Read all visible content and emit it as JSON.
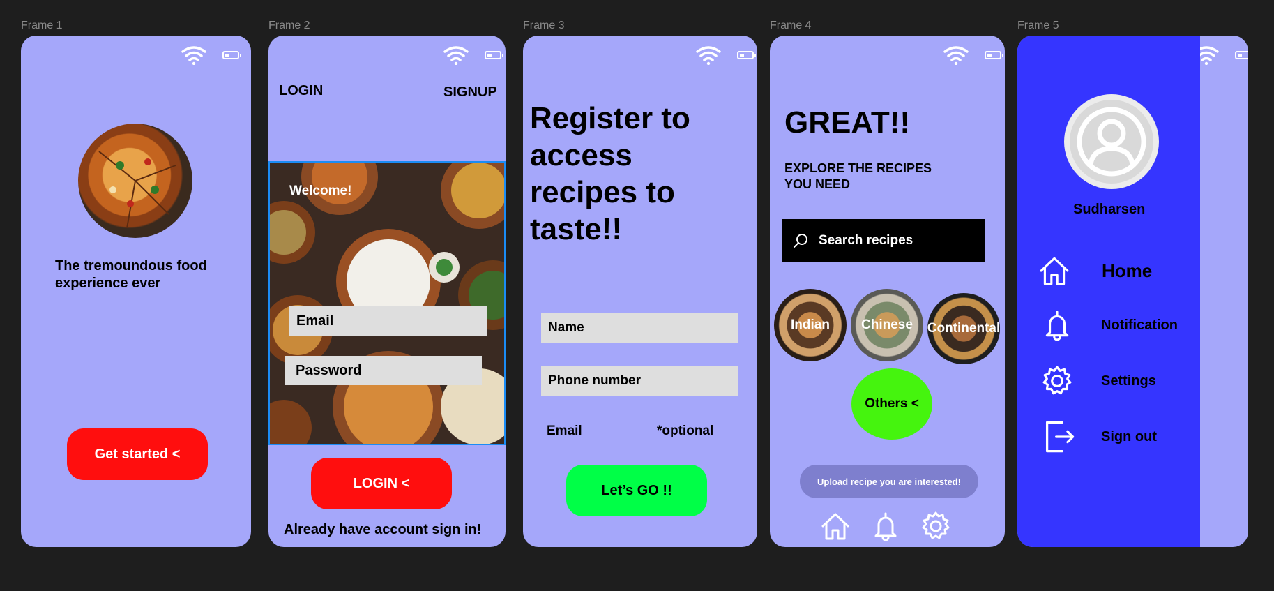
{
  "frames": {
    "f1": {
      "label": "Frame 1",
      "tagline": "The tremoundous food experience ever",
      "cta": "Get started <"
    },
    "f2": {
      "label": "Frame 2",
      "login_tab": "LOGIN",
      "signup_tab": "SIGNUP",
      "welcome": "Welcome!",
      "email_placeholder": "Email",
      "password_placeholder": "Password",
      "login_button": "LOGIN <",
      "signin_link": "Already have account sign in!"
    },
    "f3": {
      "label": "Frame 3",
      "headline": "Register to access recipes to taste!!",
      "name_field": "Name",
      "phone_field": "Phone number",
      "email_label": "Email",
      "optional_label": "*optional",
      "go_button": "Let’s GO !!"
    },
    "f4": {
      "label": "Frame 4",
      "headline": "GREAT!!",
      "subhead": "EXPLORE THE RECIPES YOU NEED",
      "search_placeholder": "Search recipes",
      "categories": [
        "Indian",
        "Chinese",
        "Continental"
      ],
      "others_button": "Others <",
      "upload_button": "Upload recipe you are interested!"
    },
    "f5": {
      "label": "Frame 5",
      "username": "Sudharsen",
      "menu": [
        {
          "label": "Home",
          "icon": "home-icon"
        },
        {
          "label": "Notification",
          "icon": "bell-icon"
        },
        {
          "label": "Settings",
          "icon": "gear-icon"
        },
        {
          "label": "Sign out",
          "icon": "sign-out-icon"
        }
      ]
    }
  },
  "colors": {
    "canvas": "#1e1e1e",
    "frame_bg": "#a5a7fa",
    "red_button": "#ff0e0e",
    "green_button": "#00ff47",
    "lime_button": "#45f40e",
    "drawer_blue": "#3535ff",
    "upload_pill": "#7e7fce"
  }
}
